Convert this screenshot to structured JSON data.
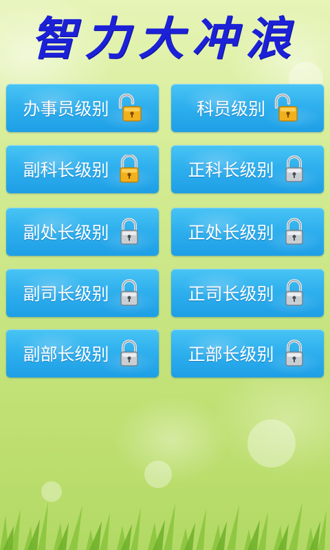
{
  "title": "智力大冲浪",
  "levels": [
    {
      "label": "办事员级别",
      "lock": "unlocked-gold-lock-icon"
    },
    {
      "label": "科员级别",
      "lock": "unlocked-gold-lock-icon"
    },
    {
      "label": "副科长级别",
      "lock": "unlocked-gold-lock-icon"
    },
    {
      "label": "正科长级别",
      "lock": "locked-gray-lock-icon"
    },
    {
      "label": "副处长级别",
      "lock": "locked-gray-lock-icon"
    },
    {
      "label": "正处长级别",
      "lock": "locked-gray-lock-icon"
    },
    {
      "label": "副司长级别",
      "lock": "locked-gray-lock-icon"
    },
    {
      "label": "正司长级别",
      "lock": "locked-gray-lock-icon"
    },
    {
      "label": "副部长级别",
      "lock": "locked-gray-lock-icon"
    },
    {
      "label": "正部长级别",
      "lock": "locked-gray-lock-icon"
    }
  ],
  "colors": {
    "title": "#1c21d8",
    "button": "#2fb0ee",
    "background": "#d4ec94"
  }
}
